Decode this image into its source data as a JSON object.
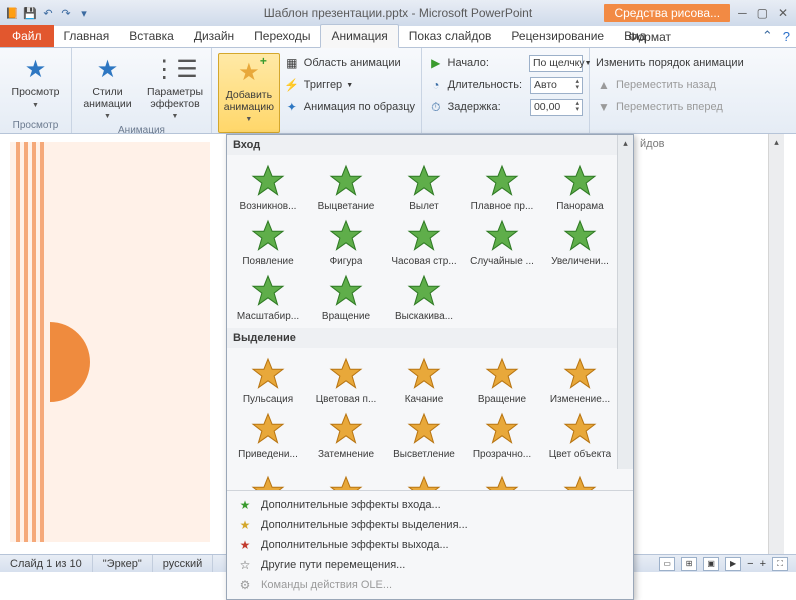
{
  "titlebar": {
    "title_doc": "Шаблон презентации.pptx",
    "title_app": " - Microsoft PowerPoint",
    "drawing_tools": "Средства рисова..."
  },
  "tabs": {
    "file": "Файл",
    "items": [
      "Главная",
      "Вставка",
      "Дизайн",
      "Переходы",
      "Анимация",
      "Показ слайдов",
      "Рецензирование",
      "Вид"
    ],
    "format": "Формат",
    "active_index": 4
  },
  "ribbon": {
    "g_view": {
      "label": "Просмотр",
      "preview": "Просмотр"
    },
    "g_anim": {
      "label": "Анимация",
      "styles": "Стили\nанимации",
      "params": "Параметры\nэффектов"
    },
    "g_add": {
      "add_btn": "Добавить\nанимацию",
      "pane": "Область анимации",
      "trigger": "Триггер",
      "painter": "Анимация по образцу"
    },
    "g_timing": {
      "start_lbl": "Начало:",
      "start_val": "По щелчку",
      "dur_lbl": "Длительность:",
      "dur_val": "Авто",
      "delay_lbl": "Задержка:",
      "delay_val": "00,00"
    },
    "g_reorder": {
      "title": "Изменить порядок анимации",
      "back": "Переместить назад",
      "fwd": "Переместить вперед"
    }
  },
  "gallery": {
    "sec_entry": "Вход",
    "entry_items": [
      "Возникнов...",
      "Выцветание",
      "Вылет",
      "Плавное пр...",
      "Панорама",
      "Появление",
      "Фигура",
      "Часовая стр...",
      "Случайные ...",
      "Увеличени...",
      "Масштабир...",
      "Вращение",
      "Выскакива..."
    ],
    "sec_emphasis": "Выделение",
    "emphasis_items": [
      "Пульсация",
      "Цветовая п...",
      "Качание",
      "Вращение",
      "Изменение...",
      "Приведени...",
      "Затемнение",
      "Высветление",
      "Прозрачно...",
      "Цвет объекта"
    ],
    "more": {
      "entry": "Дополнительные эффекты входа...",
      "emphasis": "Дополнительные эффекты выделения...",
      "exit": "Дополнительные эффекты выхода...",
      "motion": "Другие пути перемещения...",
      "ole": "Команды действия OLE..."
    }
  },
  "right_fragment": "йдов",
  "statusbar": {
    "slide": "Слайд 1 из 10",
    "theme": "\"Эркер\"",
    "lang": "русский"
  },
  "colors": {
    "entry_star": "#5fae4a",
    "emphasis_star": "#e8a83a",
    "entry_stroke": "#2f7a24",
    "emphasis_stroke": "#b87512"
  }
}
